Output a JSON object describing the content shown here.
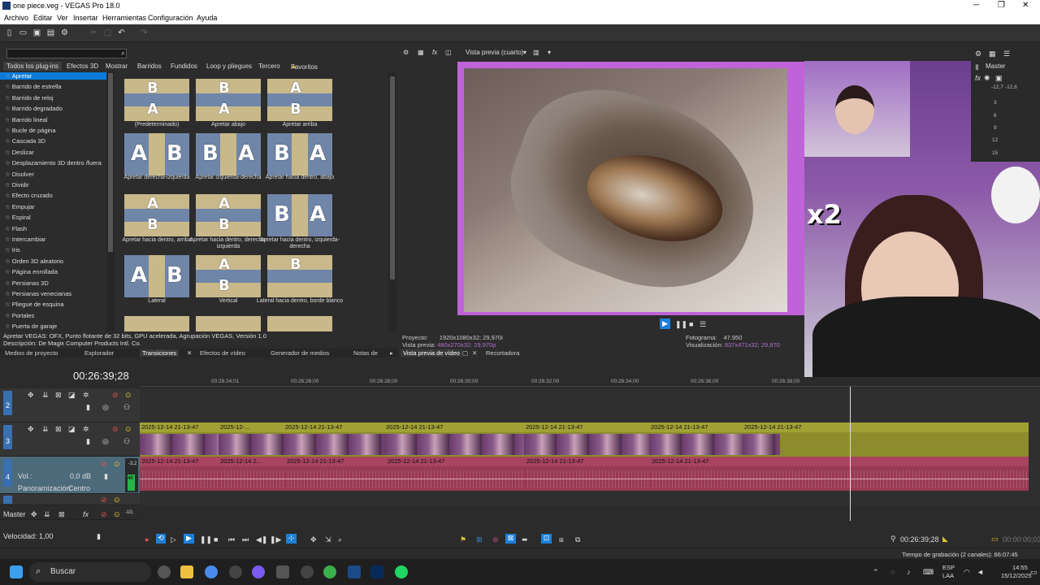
{
  "window": {
    "title": "one piece.veg - VEGAS Pro 18.0",
    "controls": [
      "─",
      "❐",
      "✕"
    ]
  },
  "menu": [
    "Archivo",
    "Editar",
    "Ver",
    "Insertar",
    "Herramientas",
    "Configuración",
    "Ayuda"
  ],
  "plugins_panel": {
    "search_value": "",
    "tabs": [
      "Todos los plug-ins",
      "Efectos 3D",
      "Mostrar",
      "Barridos",
      "Fundidos",
      "Loop y pliegues",
      "Tercero",
      "Favoritos"
    ],
    "items": [
      "Apretar",
      "Barrido de estrella",
      "Barrido de reloj",
      "Barrido degradado",
      "Barrido lineal",
      "Bucle de página",
      "Cascada 3D",
      "Deslizar",
      "Desplazamiento 3D dentro /fuera",
      "Disolver",
      "Dividir",
      "Efecto cruzado",
      "Empujar",
      "Espiral",
      "Flash",
      "Intercambiar",
      "Iris",
      "Orden 3D aleatorio",
      "Página enrollada",
      "Persianas 3D",
      "Persianas venecianas",
      "Pliegue de esquina",
      "Portales",
      "Puerta de garaje"
    ],
    "selected_item": "Apretar",
    "presets": [
      {
        "label": "(Predeterminado)"
      },
      {
        "label": "Apretar abajo"
      },
      {
        "label": "Apretar arriba"
      },
      {
        "label": "Apretar derecha-izquierda"
      },
      {
        "label": "Apretar izquierda-derecha"
      },
      {
        "label": "Apretar hacia dentro, abajo"
      },
      {
        "label": "Apretar hacia dentro, arriba"
      },
      {
        "label": "Apretar hacia dentro, derecha-izquierda"
      },
      {
        "label": "Apretar hacia dentro, izquierda-derecha"
      },
      {
        "label": "Lateral"
      },
      {
        "label": "Vertical"
      },
      {
        "label": "Lateral hacia dentro, borde blanco"
      }
    ],
    "description_line1": "Apretar VEGAS: OFX, Punto flotante de 32 bits, GPU acelerada, Agrupación VEGAS, Versión 1.0",
    "description_line2": "Descripción: De Magix Computer Products Intl. Co.",
    "bottom_tabs": [
      "Medios de proyecto",
      "Explorador",
      "Transiciones",
      "Efectos de vídeo",
      "Generador de medios",
      "Notas de"
    ]
  },
  "preview": {
    "mode_label": "Vista previa (cuarto)",
    "proyecto_label": "Proyecto:",
    "proyecto_value": "1920x1080x32; 29,970i",
    "vista_label": "Vista previa:",
    "vista_value": "480x270x32; 29,970p",
    "fotograma_label": "Fotograma:",
    "fotograma_value": "47.950",
    "visualizacion_label": "Visualización:",
    "visualizacion_value": "837x471x32; 29,970",
    "tabs": [
      "Vista previa de vídeo",
      "Recortadora"
    ]
  },
  "overlay": {
    "x2_text": "x2"
  },
  "master": {
    "label": "Master",
    "levels": [
      "-12,7",
      "-12,6"
    ],
    "scale": [
      "3",
      "6",
      "9",
      "12",
      "15"
    ]
  },
  "timeline": {
    "timecode": "00:26:39;28",
    "ruler": [
      "00:26:24;01",
      "00:26:26;00",
      "00:26:28;00",
      "00:26:30;00",
      "00:26:32;00",
      "00:26:34;00",
      "00:26:36;00",
      "00:26:38;00"
    ],
    "track_numbers": [
      "2",
      "3",
      "4"
    ],
    "video_clips": [
      "2025-12-14 21-13-47",
      "2025-12-...",
      "2025-12-14 21-13-47",
      "2025-12-14 21-13-47",
      "2025-12-14 21-13-47",
      "2025-12-14 21-13-47",
      "2025-12-14 21-13-47"
    ],
    "audio_clips": [
      "2025-12-14 21-13-47",
      "2025-12-14 2...",
      "2025-12-14 21-13-47",
      "2025-12-14 21-13-47",
      "2025-12-14 21-13-47",
      "2025-12-14 21-13-47"
    ],
    "audio_track": {
      "vol_label": "Vol.:",
      "vol_value": "0,0 dB",
      "pan_label": "Panoramización:",
      "pan_value": "Centro",
      "meter_values": [
        "-3,2",
        "48",
        "48"
      ]
    },
    "master_label": "Master",
    "master_value": "-10,"
  },
  "bottom": {
    "speed_label": "Velocidad: 1,00",
    "end_timecode": "00:26:39;28",
    "selection_timecode": "00:00:00;03",
    "record_time": "Tiempo de grabación (2 canales): 66:07:45"
  },
  "taskbar": {
    "search_placeholder": "Buscar",
    "lang_top": "ESP",
    "lang_bottom": "LAA",
    "time": "14:55",
    "date": "15/12/2025"
  },
  "colors": {
    "accent": "#0a7ad6",
    "video_clip": "#8c8c2c",
    "audio_clip": "#9a3a54",
    "preview_border": "#c063d8"
  }
}
